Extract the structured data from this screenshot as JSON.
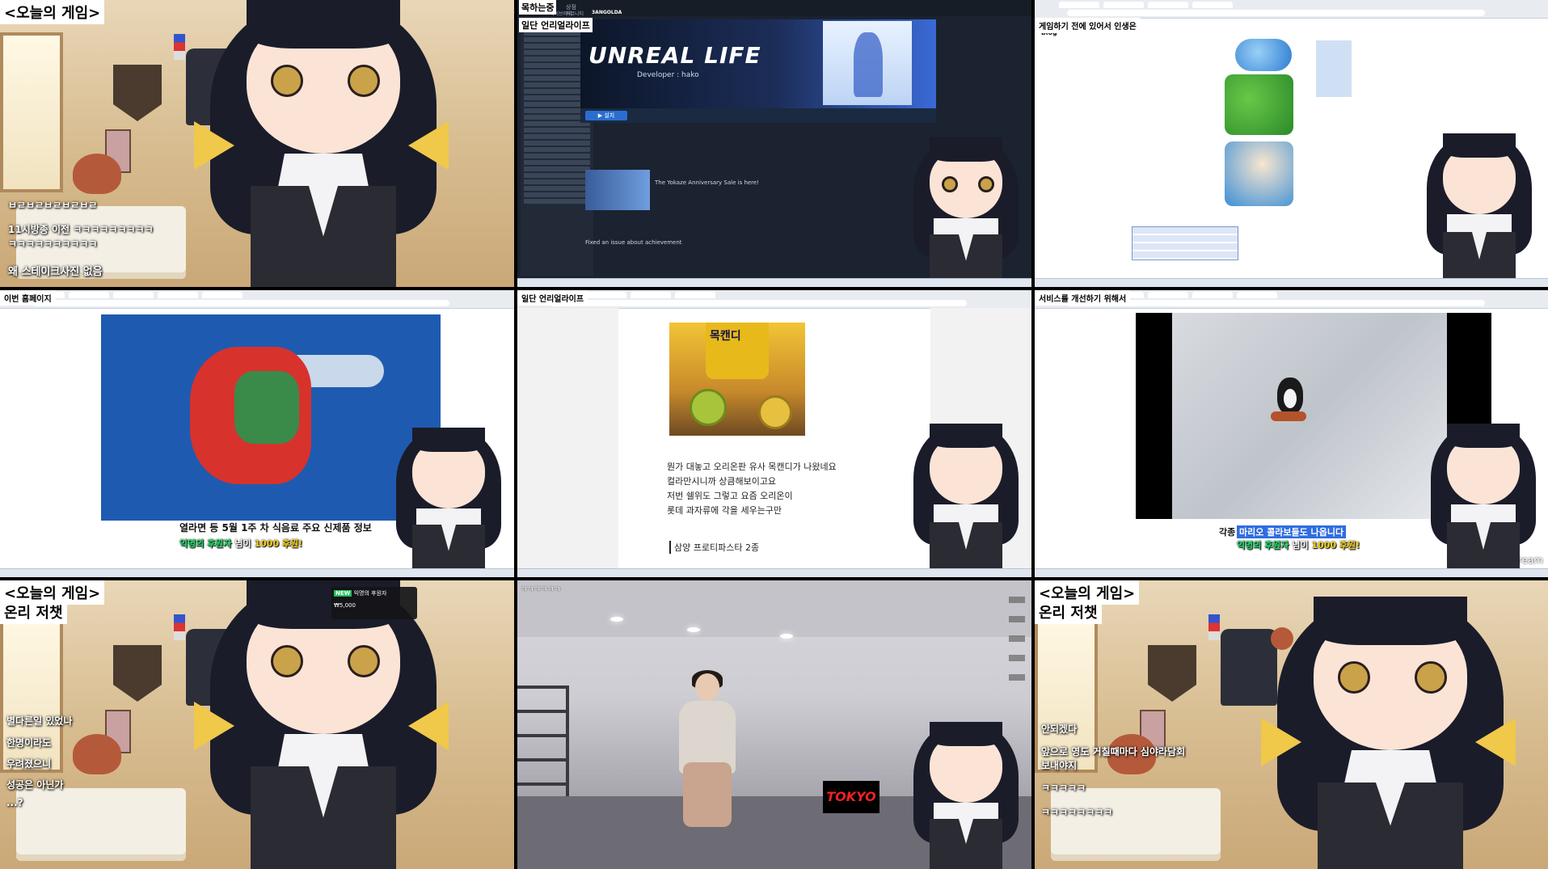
{
  "panels": {
    "p1": {
      "title": "<오늘의 게임>",
      "chat": [
        "ㅂㄹㅂㄹㅂㄹㅂㄹㅂㄹ",
        "11시방종 이전 ㅋㅋㅋㅋㅋㅋㅋㅋㅋ",
        "ㅋㅋㅋㅋㅋㅋㅋㅋㅋㅋ",
        "왜 스테이크사진 없음"
      ]
    },
    "p2": {
      "overlay_title": "목하는중",
      "overlay_sub": "일단 언리얼라이프",
      "game_logo": "UNREAL LIFE",
      "developer": "Developer : hako",
      "play_button": "▶ 설치",
      "news_headline": "The Yokaze Anniversary Sale is here!",
      "achievement": "Fixed an issue about achievement",
      "nav": [
        "상점",
        "라이브러리",
        "커뮤니티",
        "3ANGOLDA"
      ]
    },
    "p3": {
      "overlay_title": "게임하기 전에 있어서 인생은",
      "blog_label": "blog"
    },
    "p4": {
      "overlay_title": "이번 홈페이지",
      "subtitle": "열라면 등 5월 1주 차 식음료 주요 신제품 정보",
      "donation": {
        "name": "익명의 후원자",
        "mid": "님이",
        "amount": "1000 후원!"
      }
    },
    "p5": {
      "overlay_title": "일단 언리얼라이프",
      "snack_label": "목캔디",
      "lines": [
        "뭔가 대놓고 오리온판 유사 목캔디가 나왔네요",
        "컬라만시니까 상큼해보이고요",
        "저번 쉘위도 그렇고 요즘 오리온이",
        "롯데 과자류에 각을 세우는구만"
      ],
      "section": "삼양 프로티파스타 2종"
    },
    "p6": {
      "overlay_title": "서비스를 개선하기 위해서",
      "highlight": "마리오 콜라보들도 나옵니다",
      "highlight_prefix": "각종",
      "donation": {
        "name": "익명의 후원자",
        "mid": "님이",
        "amount": "1000 후원!"
      },
      "caption": "Pingu_Pingu_Dream"
    },
    "p7": {
      "title": "<오늘의 게임>",
      "subtitle": "온리 저챗",
      "alert_badge": "NEW",
      "alert_text": "익명의 후원자",
      "alert_line2": "₩5,000",
      "chat": [
        "별다른일 있었나",
        "한명이라도",
        "우려졌으니",
        "성공은 아닌가",
        "...?"
      ]
    },
    "p8": {
      "chat_header": "ㅋㅋㅋㅋㅋㅋ",
      "tokyo": "TOKYO"
    },
    "p9": {
      "title": "<오늘의 게임>",
      "subtitle": "온리 저챗",
      "chat": [
        "안되겠다",
        "앞으로 영도 거칠때마다 심야라담회",
        "보내야지",
        "ㅋㅋㅋㅋㅋ",
        "ㅋㅋㅋㅋㅋㅋㅋㅋ"
      ]
    }
  },
  "colors": {
    "hair": "#1a1c2a",
    "skin": "#fbe4d6",
    "eye": "#caa24a",
    "vest": "#2a2b33",
    "bow": "#f0c84a",
    "steam_bg": "#1b2230",
    "donation_name": "#1fe06a",
    "donation_amount": "#f5d21a"
  }
}
